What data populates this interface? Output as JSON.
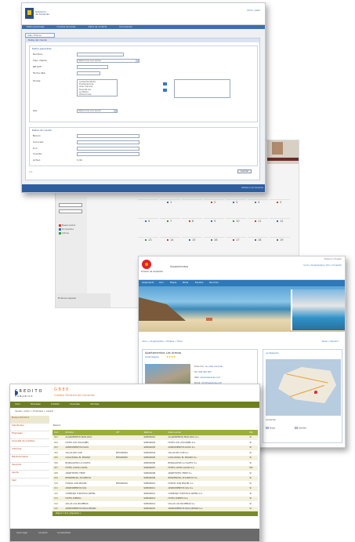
{
  "form_window": {
    "brand_line1": "Gobierno",
    "brand_line2": "de Canarias",
    "top_links": "inicio | salir",
    "nav": [
      "Datos personales",
      "Cuentas bancarias",
      "Datos de contacto",
      "Documentos"
    ],
    "tab_label": "Alta / Edicion",
    "panel_title": "Datos del cliente",
    "section1_caption": "Datos generales",
    "section2_caption": "Datos de cuenta",
    "fields1": [
      {
        "label": "Nombre:",
        "value": ""
      },
      {
        "label": "Tipo cliente:",
        "value": "Seleccione una opcion"
      },
      {
        "label": "NIF/CIF:",
        "value": ""
      },
      {
        "label": "Fecha alta:",
        "value": ""
      }
    ],
    "listbox_label": "Zonas:",
    "listbox_items": [
      "Lanzarote Norte",
      "Fuerteventura",
      "Gran Canaria",
      "Tenerife Sur",
      "La Palma",
      "Otras zonas"
    ],
    "select_label": "Isla:",
    "select_value": "Seleccione una opcion",
    "fields2": [
      {
        "label": "Banco:",
        "value": ""
      },
      {
        "label": "Sucursal:",
        "value": ""
      },
      {
        "label": "D.C.:",
        "value": ""
      },
      {
        "label": "Cuenta:",
        "value": ""
      },
      {
        "label": "Activo:",
        "value": "Si  No"
      }
    ],
    "save_label": "Guardar",
    "page_info": "1/1",
    "footer": "Gobierno de Canarias"
  },
  "calendar_window": {
    "legend": [
      "Reservados",
      "Ocupados",
      "Libres"
    ],
    "footer": "Enlaces legales",
    "weeks": [
      [
        "",
        "1",
        "",
        "2",
        "3",
        "4",
        "5"
      ],
      [
        "6",
        "7",
        "8",
        "9",
        "10",
        "11",
        "12"
      ],
      [
        "13",
        "14",
        "15",
        "16",
        "17",
        "18",
        "19"
      ],
      [
        "20",
        "21",
        "22",
        "23",
        "24",
        "25",
        "26"
      ],
      [
        "27",
        "28",
        "29",
        "30",
        "31",
        "",
        ""
      ]
    ]
  },
  "tourism_window": {
    "brand": "Turismo de Lanzarote",
    "mid_title": "Alojamientos",
    "header_right": "Inicio | Alojamientos | Ocio | Contacto",
    "top_right": "Espanol | English",
    "nav": [
      "Alojamiento",
      "Ocio",
      "Playas",
      "Rutas",
      "Eventos",
      "Servicios"
    ],
    "breadcrumb": "Inicio > Alojamientos > Hoteles > Ficha",
    "breadcrumb_right": "Volver | Imprimir",
    "hotel_name": "Apartamentos Las Arenas",
    "hotel_zone": "Costa Teguise",
    "stars": "★★★★",
    "info": [
      {
        "k": "Direccion:",
        "v": "Av. Islas Canarias"
      },
      {
        "k": "Tel:",
        "v": "928 000 000"
      },
      {
        "k": "Web:",
        "v": "www.lasarenas.com"
      },
      {
        "k": "Email:",
        "v": "info@lasarenas.com"
      },
      {
        "k": "Plazas:",
        "v": "120"
      }
    ],
    "tabs": [
      "Descripcion",
      "Servicios",
      "Tarifas",
      "Reservar"
    ],
    "map_title": "Localizacion",
    "map_caption": "Lanzarote",
    "map_toggles": [
      "Mapa",
      "Satelite"
    ]
  },
  "credit_window": {
    "logo": "CREDITO",
    "logo_small": "CANARIAS",
    "title1": "G B E E",
    "title2": "Credito Turistico de Canarias",
    "bar": [
      "Inicio",
      "Empresas",
      "Creditos",
      "Consultas",
      "Informes"
    ],
    "subnav": "Usuario: admin > Empresas > Listado",
    "sidebar": [
      "Nueva Solicitud",
      "Solicitudes",
      "Empresas",
      "Consulta de Creditos",
      "Informes",
      "Mantenimiento",
      "Usuarios",
      "Ayuda",
      "Salir"
    ],
    "search_label": "Buscar:",
    "table_headers": [
      "Cod.",
      "Nombre",
      "CIF",
      "Telefono",
      "Razon social",
      "Est."
    ],
    "rows": [
      [
        "001",
        "ALOJAMIENTOS MAR AZUL",
        "",
        "928000001",
        "ALOJAMIENTOS MAR AZUL S.L.",
        "SI"
      ],
      [
        "002",
        "HOTEL LOS VOLCANES",
        "",
        "928000002",
        "HOTEL LOS VOLCANES S.A.",
        "SI"
      ],
      [
        "003",
        "APARTAMENTOS PLAYA",
        "",
        "928000003",
        "APARTAMENTOS PLAYA S.L.",
        "SI"
      ],
      [
        "004",
        "VILLAS DEL SUR",
        "B35000004",
        "928000004",
        "VILLAS DEL SUR S.L.",
        "SI"
      ],
      [
        "005",
        "CASA RURAL EL MOLINO",
        "B35000005",
        "928000005",
        "CASA RURAL EL MOLINO S.L.",
        "SI"
      ],
      [
        "006",
        "BUNGALOWS LA CALETA",
        "",
        "928000006",
        "BUNGALOWS LA CALETA S.L.",
        "SI"
      ],
      [
        "007",
        "HOTEL COSTA CALMA",
        "",
        "928000007",
        "HOTEL COSTA CALMA S.A.",
        "NO"
      ],
      [
        "008",
        "APARTHOTEL TEIDE",
        "",
        "928000008",
        "APARTHOTEL TEIDE S.L.",
        "SI"
      ],
      [
        "009",
        "RESIDENCIAL ATLANTICO",
        "",
        "928000009",
        "RESIDENCIAL ATLANTICO S.L.",
        "SI"
      ],
      [
        "010",
        "HOSTAL SAN MIGUEL",
        "B35000010",
        "928000010",
        "HOSTAL SAN MIGUEL S.L.",
        "SI"
      ],
      [
        "011",
        "APARTAMENTOS SOL",
        "",
        "928000011",
        "APARTAMENTOS SOL S.L.",
        "SI"
      ],
      [
        "012",
        "COMPLEJO TURISTICO ARENA",
        "",
        "928000012",
        "COMPLEJO TURISTICO ARENA S.A.",
        "SI"
      ],
      [
        "013",
        "HOTEL PUERTO",
        "",
        "928000013",
        "HOTEL PUERTO S.A.",
        "SI"
      ],
      [
        "014",
        "VILLAS LAS PALMERAS",
        "",
        "928000014",
        "VILLAS LAS PALMERAS S.L.",
        "SI"
      ],
      [
        "015",
        "APARTAMENTOS ROCA NEGRA",
        "",
        "928000015",
        "APARTAMENTOS ROCA NEGRA S.L.",
        "SI"
      ]
    ],
    "pager": "Pagina 1 de 4  |  Siguiente >",
    "footer": [
      "Aviso legal",
      "Contacto",
      "Accesibilidad"
    ]
  }
}
